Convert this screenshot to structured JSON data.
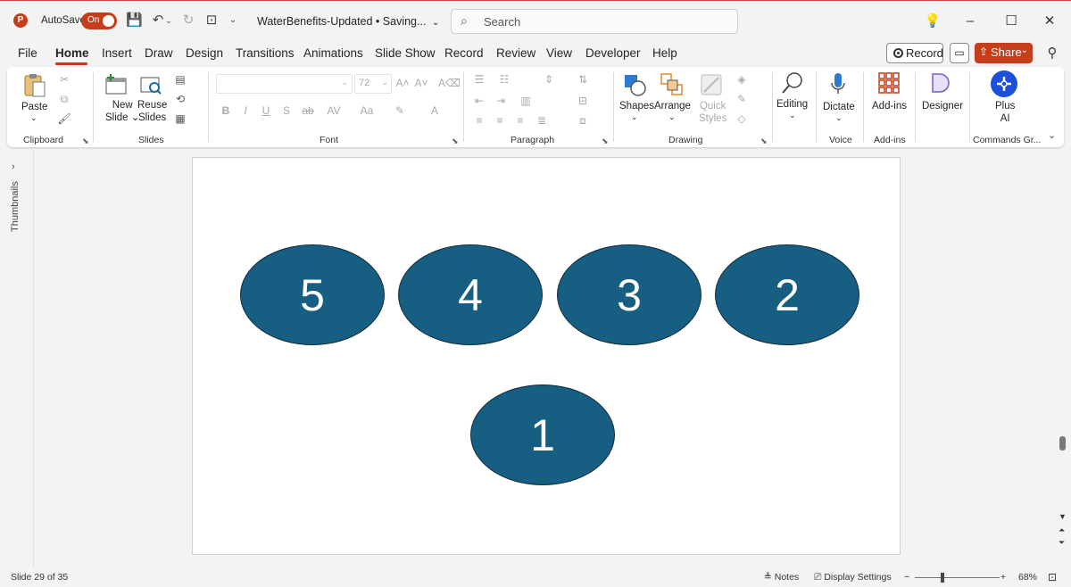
{
  "titlebar": {
    "logo_letter": "P",
    "autosave_label": "AutoSave",
    "autosave_state": "On",
    "doc_title": "WaterBenefits-Updated • Saving...",
    "search_placeholder": "Search"
  },
  "tabs": [
    "File",
    "Home",
    "Insert",
    "Draw",
    "Design",
    "Transitions",
    "Animations",
    "Slide Show",
    "Record",
    "Review",
    "View",
    "Developer",
    "Help"
  ],
  "active_tab": "Home",
  "top_buttons": {
    "record": "Record",
    "share": "Share"
  },
  "ribbon": {
    "clipboard": {
      "paste": "Paste",
      "label": "Clipboard"
    },
    "slides": {
      "new_slide_1": "New",
      "new_slide_2": "Slide",
      "reuse_1": "Reuse",
      "reuse_2": "Slides",
      "label": "Slides"
    },
    "font": {
      "size": "72",
      "label": "Font"
    },
    "paragraph": {
      "label": "Paragraph"
    },
    "drawing": {
      "shapes": "Shapes",
      "arrange": "Arrange",
      "quick_1": "Quick",
      "quick_2": "Styles",
      "label": "Drawing"
    },
    "editing": {
      "label": "Editing"
    },
    "voice": {
      "dictate": "Dictate",
      "label": "Voice"
    },
    "addins": {
      "addins": "Add-ins",
      "label": "Add-ins"
    },
    "designer": {
      "label": "Designer"
    },
    "commands": {
      "plus_1": "Plus",
      "plus_2": "AI",
      "label": "Commands Gr..."
    }
  },
  "thumbnails_label": "Thumbnails",
  "slide_shapes": [
    "5",
    "4",
    "3",
    "2",
    "1"
  ],
  "status": {
    "slide_info": "Slide 29 of 35",
    "notes": "Notes",
    "display_settings": "Display Settings",
    "zoom": "68%"
  },
  "colors": {
    "accent": "#c43e1c",
    "ellipse_fill": "#175f82"
  }
}
